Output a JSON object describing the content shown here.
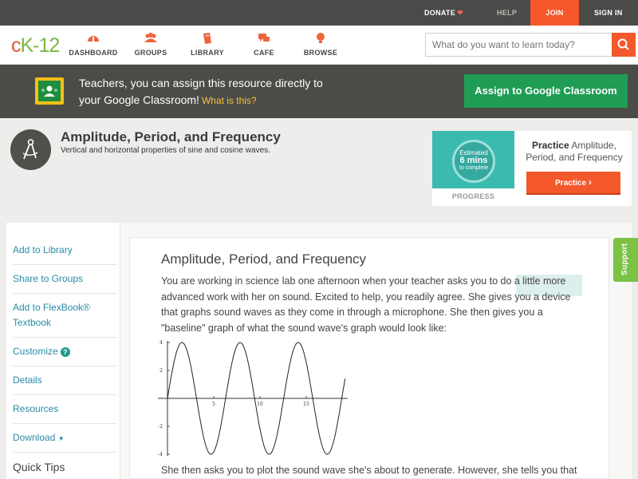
{
  "topbar": {
    "donate": "DONATE",
    "help": "HELP",
    "join": "JOIN",
    "signin": "SIGN IN"
  },
  "nav": {
    "logo_c": "c",
    "logo_k": "K-12",
    "items": [
      {
        "label": "DASHBOARD",
        "icon": "dashboard-icon"
      },
      {
        "label": "GROUPS",
        "icon": "groups-icon"
      },
      {
        "label": "LIBRARY",
        "icon": "library-icon"
      },
      {
        "label": "CAFE",
        "icon": "cafe-icon"
      },
      {
        "label": "BROWSE",
        "icon": "browse-icon"
      }
    ],
    "search_placeholder": "What do you want to learn today?"
  },
  "classroom_banner": {
    "line1": "Teachers, you can assign this resource directly to",
    "line2": "your Google Classroom!",
    "what_link": "What is this?",
    "button": "Assign to Google Classroom"
  },
  "concept": {
    "title": "Amplitude, Period, and Frequency",
    "subtitle": "Vertical and horizontal properties of sine and cosine waves."
  },
  "practice_card": {
    "estimated_label": "Estimated",
    "estimated_value": "6 mins",
    "estimated_suffix": "to complete",
    "progress_label": "PROGRESS",
    "practice_bold": "Practice",
    "practice_text": "Amplitude, Period, and Frequency",
    "button": "Practice"
  },
  "sidebar": {
    "items": [
      {
        "label": "Add to Library"
      },
      {
        "label": "Share to Groups"
      },
      {
        "label": "Add to FlexBook® Textbook"
      },
      {
        "label": "Customize"
      },
      {
        "label": "Details"
      },
      {
        "label": "Resources"
      },
      {
        "label": "Download"
      }
    ],
    "quick_tips": "Quick Tips"
  },
  "content": {
    "title": "Amplitude, Period, and Frequency",
    "paragraph1": "You are working in science lab one afternoon when your teacher asks you to do a little more advanced work with her on sound. Excited to help, you readily agree. She gives you a device that graphs sound waves as they come in through a microphone. She then gives you a \"baseline\" graph of what the sound wave's graph would look like:",
    "paragraph2": "She then asks you to plot the sound wave she's about to generate. However, she tells you that",
    "graph": {
      "y_ticks": [
        "4",
        "2",
        "−2",
        "−4"
      ],
      "x_ticks": [
        "5",
        "10",
        "15"
      ],
      "amplitude": 4,
      "period": 6.28
    }
  },
  "support_tab": "Support"
}
